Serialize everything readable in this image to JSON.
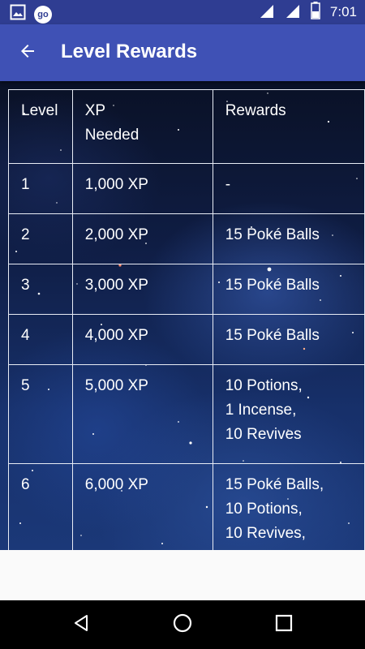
{
  "status_bar": {
    "time": "7:01",
    "go_badge": "go"
  },
  "toolbar": {
    "title": "Level Rewards"
  },
  "table": {
    "headers": {
      "level": "Level",
      "xp_line1": "XP",
      "xp_line2": "Needed",
      "rewards": "Rewards"
    },
    "rows": [
      {
        "level": "1",
        "xp": "1,000 XP",
        "rewards": [
          "-"
        ]
      },
      {
        "level": "2",
        "xp": "2,000 XP",
        "rewards": [
          "15 Poké Balls"
        ]
      },
      {
        "level": "3",
        "xp": "3,000 XP",
        "rewards": [
          "15 Poké Balls"
        ]
      },
      {
        "level": "4",
        "xp": "4,000 XP",
        "rewards": [
          "15 Poké Balls"
        ]
      },
      {
        "level": "5",
        "xp": "5,000 XP",
        "rewards": [
          "10 Potions,",
          "1 Incense,",
          "10 Revives"
        ]
      },
      {
        "level": "6",
        "xp": "6,000 XP",
        "rewards": [
          "15 Poké Balls,",
          "10 Potions,",
          "10 Revives,"
        ]
      }
    ]
  },
  "colors": {
    "status_bar": "#2f3d92",
    "toolbar": "#3f51b5",
    "nav_bar": "#000000"
  },
  "icons": [
    "image-icon",
    "go-icon",
    "signal-icon",
    "battery-icon",
    "back-arrow-icon",
    "nav-back-icon",
    "nav-home-icon",
    "nav-recents-icon"
  ]
}
